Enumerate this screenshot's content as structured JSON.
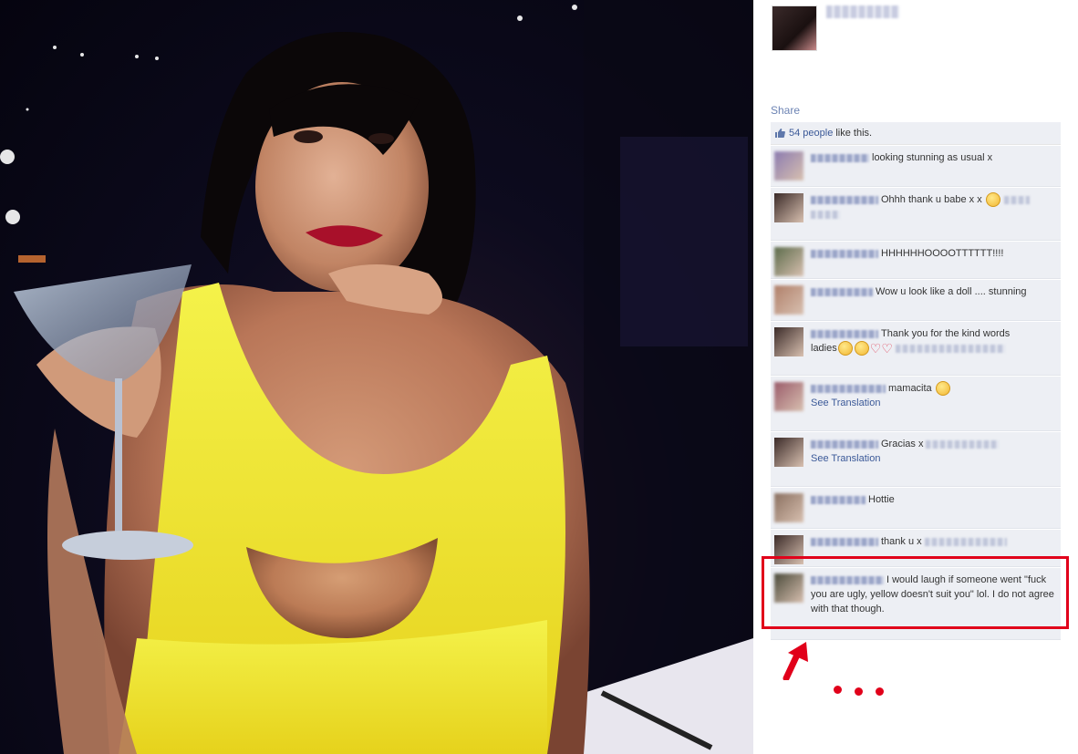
{
  "share_label": "Share",
  "likes": {
    "count_text": "54 people",
    "suffix": "like this."
  },
  "comments": [
    {
      "text": "looking stunning as usual x",
      "name_w": 64,
      "avatar_color": "#8b7bb0"
    },
    {
      "text": "Ohhh thank u babe x x",
      "name_w": 74,
      "avatar_color": "#3a2a28",
      "emoji": true,
      "tail_w": 28,
      "tail_line2_w": 32
    },
    {
      "text": "HHHHHHOOOOTTTTTT!!!!",
      "name_w": 74,
      "avatar_color": "#5b6b4a"
    },
    {
      "text": "Wow u look like a doll .... stunning",
      "name_w": 68,
      "avatar_color": "#b0806a"
    },
    {
      "text": "Thank you for the kind words",
      "text_line2": "ladies",
      "name_w": 74,
      "avatar_color": "#3a2a28",
      "tail_w": 120
    },
    {
      "text": "mamacita",
      "name_w": 82,
      "avatar_color": "#9a5b6a",
      "translation": "See Translation"
    },
    {
      "text": "Gracias x",
      "name_w": 74,
      "avatar_color": "#3a2a28",
      "translation": "See Translation",
      "tail_w": 80
    },
    {
      "text": "Hottie",
      "name_w": 60,
      "avatar_color": "#8a7060"
    },
    {
      "text": "thank u x",
      "name_w": 74,
      "avatar_color": "#3a2a28",
      "tail_w": 90
    },
    {
      "text": "I would laugh if someone went \"fuck you are ugly, yellow doesn't suit you\" lol. I do not agree with that though.",
      "name_w": 80,
      "avatar_color": "#4a4a3a"
    }
  ],
  "colors": {
    "link": "#3b5998",
    "highlight": "#e1001a",
    "comment_bg": "#edeff4"
  }
}
